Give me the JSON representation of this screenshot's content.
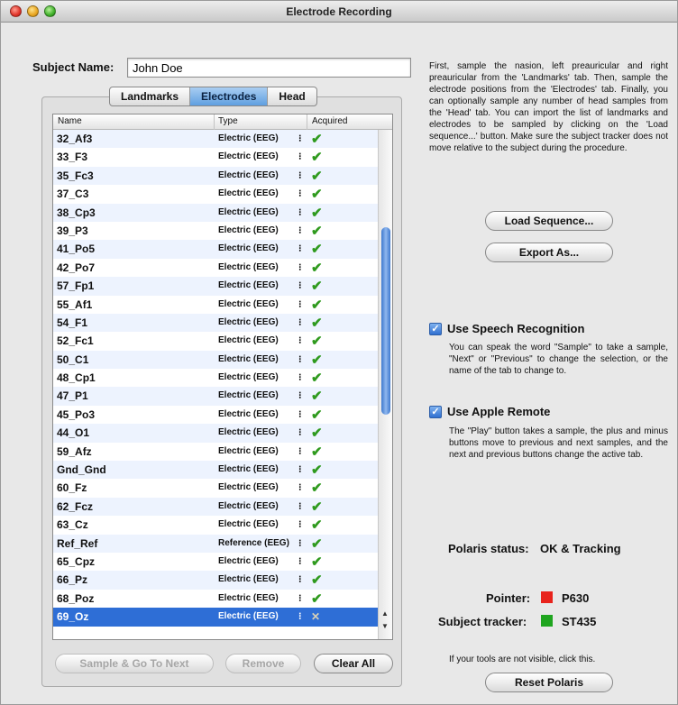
{
  "window": {
    "title": "Electrode Recording"
  },
  "subject": {
    "label": "Subject Name:",
    "value": "John Doe"
  },
  "tabs": [
    "Landmarks",
    "Electrodes",
    "Head"
  ],
  "table": {
    "headers": [
      "Name",
      "Type",
      "Acquired"
    ],
    "rows": [
      {
        "name": "32_Af3",
        "type": "Electric (EEG)",
        "acquired": true
      },
      {
        "name": "33_F3",
        "type": "Electric (EEG)",
        "acquired": true
      },
      {
        "name": "35_Fc3",
        "type": "Electric (EEG)",
        "acquired": true
      },
      {
        "name": "37_C3",
        "type": "Electric (EEG)",
        "acquired": true
      },
      {
        "name": "38_Cp3",
        "type": "Electric (EEG)",
        "acquired": true
      },
      {
        "name": "39_P3",
        "type": "Electric (EEG)",
        "acquired": true
      },
      {
        "name": "41_Po5",
        "type": "Electric (EEG)",
        "acquired": true
      },
      {
        "name": "42_Po7",
        "type": "Electric (EEG)",
        "acquired": true
      },
      {
        "name": "57_Fp1",
        "type": "Electric (EEG)",
        "acquired": true
      },
      {
        "name": "55_Af1",
        "type": "Electric (EEG)",
        "acquired": true
      },
      {
        "name": "54_F1",
        "type": "Electric (EEG)",
        "acquired": true
      },
      {
        "name": "52_Fc1",
        "type": "Electric (EEG)",
        "acquired": true
      },
      {
        "name": "50_C1",
        "type": "Electric (EEG)",
        "acquired": true
      },
      {
        "name": "48_Cp1",
        "type": "Electric (EEG)",
        "acquired": true
      },
      {
        "name": "47_P1",
        "type": "Electric (EEG)",
        "acquired": true
      },
      {
        "name": "45_Po3",
        "type": "Electric (EEG)",
        "acquired": true
      },
      {
        "name": "44_O1",
        "type": "Electric (EEG)",
        "acquired": true
      },
      {
        "name": "59_Afz",
        "type": "Electric (EEG)",
        "acquired": true
      },
      {
        "name": "Gnd_Gnd",
        "type": "Electric (EEG)",
        "acquired": true
      },
      {
        "name": "60_Fz",
        "type": "Electric (EEG)",
        "acquired": true
      },
      {
        "name": "62_Fcz",
        "type": "Electric (EEG)",
        "acquired": true
      },
      {
        "name": "63_Cz",
        "type": "Electric (EEG)",
        "acquired": true
      },
      {
        "name": "Ref_Ref",
        "type": "Reference (EEG)",
        "acquired": true
      },
      {
        "name": "65_Cpz",
        "type": "Electric (EEG)",
        "acquired": true
      },
      {
        "name": "66_Pz",
        "type": "Electric (EEG)",
        "acquired": true
      },
      {
        "name": "68_Poz",
        "type": "Electric (EEG)",
        "acquired": true
      },
      {
        "name": "69_Oz",
        "type": "Electric (EEG)",
        "acquired": false,
        "selected": true
      }
    ]
  },
  "buttons": {
    "sample_next": "Sample & Go To Next",
    "remove": "Remove",
    "clear_all": "Clear All",
    "load_sequence": "Load Sequence...",
    "export_as": "Export As...",
    "reset_polaris": "Reset Polaris"
  },
  "instructions": "First, sample the nasion, left preauricular and right preauricular from the 'Landmarks' tab. Then, sample the electrode positions from the 'Electrodes' tab. Finally, you can optionally sample any number of head samples from the 'Head' tab. You can import the list of landmarks and electrodes to be sampled by clicking on the 'Load sequence...' button. Make sure the subject tracker does not move relative to the subject during the procedure.",
  "speech": {
    "label": "Use Speech Recognition",
    "checked": true,
    "desc": "You can speak the word \"Sample\" to take a sample, \"Next\" or \"Previous\" to change the selection, or the name of the tab to change to."
  },
  "remote": {
    "label": "Use Apple Remote",
    "checked": true,
    "desc": "The \"Play\" button takes a sample, the plus and minus buttons move to previous and next samples, and the next and previous buttons change the active tab."
  },
  "polaris": {
    "status_label": "Polaris status:",
    "status_value": "OK & Tracking",
    "pointer_label": "Pointer:",
    "pointer_id": "P630",
    "pointer_color": "#e8231c",
    "tracker_label": "Subject tracker:",
    "tracker_id": "ST435",
    "tracker_color": "#1fa51f",
    "hint": "If your tools are not visible, click this."
  },
  "icons": {
    "check": "check-icon",
    "acquired_none": "cross-icon",
    "stepper": "stepper-icon"
  }
}
